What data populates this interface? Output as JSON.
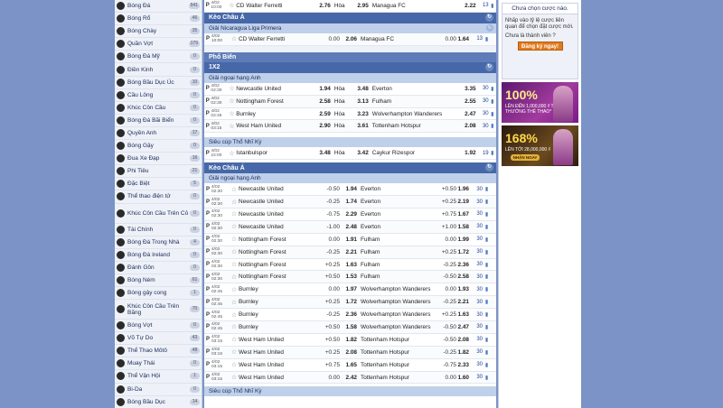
{
  "sidebar": [
    {
      "icon": "soccer-ball-icon",
      "label": "Bóng Đá",
      "count": "541"
    },
    {
      "icon": "basketball-icon",
      "label": "Bóng Rổ",
      "count": "46"
    },
    {
      "icon": "baseball-icon",
      "label": "Bóng Chày",
      "count": "35"
    },
    {
      "icon": "tennis-icon",
      "label": "Quần Vợt",
      "count": "179"
    },
    {
      "icon": "american-football-icon",
      "label": "Bóng Đá Mỹ",
      "count": "0"
    },
    {
      "icon": "athletics-icon",
      "label": "Điền Kinh",
      "count": "0"
    },
    {
      "icon": "rugby-icon",
      "label": "Bóng Bầu Dục Úc",
      "count": "10"
    },
    {
      "icon": "badminton-icon",
      "label": "Cầu Lông",
      "count": "0"
    },
    {
      "icon": "ice-hockey-icon",
      "label": "Khúc Côn Cầu",
      "count": "0"
    },
    {
      "icon": "beach-soccer-icon",
      "label": "Bóng Đá Bãi Biển",
      "count": "0"
    },
    {
      "icon": "boxing-icon",
      "label": "Quyền Anh",
      "count": "17"
    },
    {
      "icon": "hockey-icon",
      "label": "Bóng Gậy",
      "count": "0"
    },
    {
      "icon": "cycling-icon",
      "label": "Đua Xe Đạp",
      "count": "16"
    },
    {
      "icon": "darts-icon",
      "label": "Phi Tiêu",
      "count": "21"
    },
    {
      "icon": "specials-icon",
      "label": "Đặc Biệt",
      "count": "5"
    },
    {
      "icon": "esports-icon",
      "label": "Thể thao điện tử",
      "count": "0"
    },
    {
      "icon": "ice-hockey-icon",
      "label": "Khúc Côn Cầu Trên Cỏ",
      "count": "0",
      "tall": true
    },
    {
      "icon": "finance-icon",
      "label": "Tài Chính",
      "count": "0"
    },
    {
      "icon": "futsal-icon",
      "label": "Bóng Đá Trong Nhà",
      "count": "4"
    },
    {
      "icon": "gaelic-football-icon",
      "label": "Bóng Đá Ireland",
      "count": "0"
    },
    {
      "icon": "golf-icon",
      "label": "Đánh Gôn",
      "count": "0"
    },
    {
      "icon": "handball-icon",
      "label": "Bóng Ném",
      "count": "61"
    },
    {
      "icon": "hurling-icon",
      "label": "Bóng gậy cong",
      "count": "1"
    },
    {
      "icon": "ice-hockey-icon",
      "label": "Khúc Côn Cầu Trên Băng",
      "count": "70",
      "tall": true
    },
    {
      "icon": "tennis-icon",
      "label": "Bóng Vợt",
      "count": "0"
    },
    {
      "icon": "martial-arts-icon",
      "label": "Võ Tự Do",
      "count": "43"
    },
    {
      "icon": "motorsport-icon",
      "label": "Thể Thao Môtô",
      "count": "48"
    },
    {
      "icon": "muay-thai-icon",
      "label": "Muay Thái",
      "count": "0"
    },
    {
      "icon": "olympics-icon",
      "label": "Thể Vận Hội",
      "count": "1"
    },
    {
      "icon": "billiards-icon",
      "label": "Bi-Da",
      "count": "0"
    },
    {
      "icon": "rugby-icon",
      "label": "Bóng Bầu Dục",
      "count": "14"
    }
  ],
  "top": {
    "row1": {
      "date": "4/02",
      "time": "10:00",
      "home": "CD Walter Ferretti",
      "hodd": "2.76",
      "draw": "Hòa",
      "dodd": "2.95",
      "away": "Managua FC",
      "aodd": "2.22",
      "n": "13"
    },
    "kc_title": "Kèo Châu Á",
    "league": "Giải Nicaragua Liga Primera",
    "row2": {
      "date": "4/02",
      "time": "10:00",
      "home": "CD Walter Ferretti",
      "hcp": "0.00",
      "hodd": "2.06",
      "away": "Managua FC",
      "ahcp": "0.00",
      "aodd": "1.64",
      "n": "13"
    }
  },
  "pho_bien": "Phổ Biến",
  "x12": {
    "title": "1X2",
    "league1": "Giải ngoại hạng Anh",
    "rows": [
      {
        "date": "4/02",
        "time": "02:30",
        "home": "Newcastle United",
        "hodd": "1.94",
        "draw": "Hòa",
        "dodd": "3.48",
        "away": "Everton",
        "aodd": "3.35",
        "n": "30"
      },
      {
        "date": "4/02",
        "time": "02:30",
        "home": "Nottingham Forest",
        "hodd": "2.58",
        "draw": "Hòa",
        "dodd": "3.13",
        "away": "Fulham",
        "aodd": "2.55",
        "n": "30"
      },
      {
        "date": "4/02",
        "time": "02:45",
        "home": "Burnley",
        "hodd": "2.59",
        "draw": "Hòa",
        "dodd": "3.23",
        "away": "Wolverhampton Wanderers",
        "aodd": "2.47",
        "n": "30"
      },
      {
        "date": "4/02",
        "time": "03:15",
        "home": "West Ham United",
        "hodd": "2.90",
        "draw": "Hòa",
        "dodd": "3.61",
        "away": "Tottenham Hotspur",
        "aodd": "2.08",
        "n": "30"
      }
    ],
    "league2": "Siêu cúp Thổ Nhĩ Kỳ",
    "rows2": [
      {
        "date": "4/02",
        "time": "22:00",
        "home": "Istanbulspor",
        "hodd": "3.48",
        "draw": "Hòa",
        "dodd": "3.42",
        "away": "Caykur Rizespor",
        "aodd": "1.92",
        "n": "19"
      }
    ]
  },
  "asian": {
    "title": "Kèo Châu Á",
    "league1": "Giải ngoại hạng Anh",
    "rows": [
      {
        "date": "4/02",
        "time": "02:30",
        "home": "Newcastle United",
        "hcp": "-0.50",
        "hodd": "1.94",
        "away": "Everton",
        "ahcp": "+0.50",
        "aodd": "1.96",
        "n": "30"
      },
      {
        "date": "4/02",
        "time": "02:30",
        "home": "Newcastle United",
        "hcp": "-0.25",
        "hodd": "1.74",
        "away": "Everton",
        "ahcp": "+0.25",
        "aodd": "2.19",
        "n": "30"
      },
      {
        "date": "4/02",
        "time": "02:30",
        "home": "Newcastle United",
        "hcp": "-0.75",
        "hodd": "2.29",
        "away": "Everton",
        "ahcp": "+0.75",
        "aodd": "1.67",
        "n": "30"
      },
      {
        "date": "4/02",
        "time": "02:30",
        "home": "Newcastle United",
        "hcp": "-1.00",
        "hodd": "2.48",
        "away": "Everton",
        "ahcp": "+1.00",
        "aodd": "1.58",
        "n": "30"
      },
      {
        "date": "4/02",
        "time": "02:30",
        "home": "Nottingham Forest",
        "hcp": "0.00",
        "hodd": "1.91",
        "away": "Fulham",
        "ahcp": "0.00",
        "aodd": "1.99",
        "n": "30"
      },
      {
        "date": "4/02",
        "time": "02:30",
        "home": "Nottingham Forest",
        "hcp": "-0.25",
        "hodd": "2.21",
        "away": "Fulham",
        "ahcp": "+0.25",
        "aodd": "1.72",
        "n": "30"
      },
      {
        "date": "4/02",
        "time": "02:30",
        "home": "Nottingham Forest",
        "hcp": "+0.25",
        "hodd": "1.63",
        "away": "Fulham",
        "ahcp": "-0.25",
        "aodd": "2.36",
        "n": "30"
      },
      {
        "date": "4/02",
        "time": "02:30",
        "home": "Nottingham Forest",
        "hcp": "+0.50",
        "hodd": "1.53",
        "away": "Fulham",
        "ahcp": "-0.50",
        "aodd": "2.58",
        "n": "30"
      },
      {
        "date": "4/02",
        "time": "02:45",
        "home": "Burnley",
        "hcp": "0.00",
        "hodd": "1.97",
        "away": "Wolverhampton Wanderers",
        "ahcp": "0.00",
        "aodd": "1.93",
        "n": "30"
      },
      {
        "date": "4/02",
        "time": "02:45",
        "home": "Burnley",
        "hcp": "+0.25",
        "hodd": "1.72",
        "away": "Wolverhampton Wanderers",
        "ahcp": "-0.25",
        "aodd": "2.21",
        "n": "30"
      },
      {
        "date": "4/02",
        "time": "02:45",
        "home": "Burnley",
        "hcp": "-0.25",
        "hodd": "2.36",
        "away": "Wolverhampton Wanderers",
        "ahcp": "+0.25",
        "aodd": "1.63",
        "n": "30"
      },
      {
        "date": "4/02",
        "time": "02:45",
        "home": "Burnley",
        "hcp": "+0.50",
        "hodd": "1.58",
        "away": "Wolverhampton Wanderers",
        "ahcp": "-0.50",
        "aodd": "2.47",
        "n": "30"
      },
      {
        "date": "4/02",
        "time": "03:15",
        "home": "West Ham United",
        "hcp": "+0.50",
        "hodd": "1.82",
        "away": "Tottenham Hotspur",
        "ahcp": "-0.50",
        "aodd": "2.08",
        "n": "30"
      },
      {
        "date": "4/02",
        "time": "03:15",
        "home": "West Ham United",
        "hcp": "+0.25",
        "hodd": "2.08",
        "away": "Tottenham Hotspur",
        "ahcp": "-0.25",
        "aodd": "1.82",
        "n": "30"
      },
      {
        "date": "4/02",
        "time": "03:15",
        "home": "West Ham United",
        "hcp": "+0.75",
        "hodd": "1.65",
        "away": "Tottenham Hotspur",
        "ahcp": "-0.75",
        "aodd": "2.33",
        "n": "30"
      },
      {
        "date": "4/02",
        "time": "03:15",
        "home": "West Ham United",
        "hcp": "0.00",
        "hodd": "2.42",
        "away": "Tottenham Hotspur",
        "ahcp": "0.00",
        "aodd": "1.60",
        "n": "30"
      }
    ],
    "league2": "Siêu cúp Thổ Nhĩ Kỳ"
  },
  "betslip": {
    "head": "Chưa chọn cược nào.",
    "text": "Nhấp vào tỷ lệ cược liên quan để chọn đặt cược mới.",
    "question": "Chưa là thành viên ?",
    "button": "Đăng ký ngay!"
  },
  "banner1": {
    "big": "100%",
    "small": "LÊN ĐẾN 1,000,000 ₫ TIỀN THƯỞNG THỂ THAO*"
  },
  "banner2": {
    "big": "168%",
    "small": "LÊN TỚI 28,000,000 ₫",
    "cta": "NHẬN NGAY"
  },
  "colors": {
    "accent": "#4768a8",
    "league": "#bfd0ea",
    "cta": "#e07b1e",
    "page_bg": "#7b93c6"
  }
}
